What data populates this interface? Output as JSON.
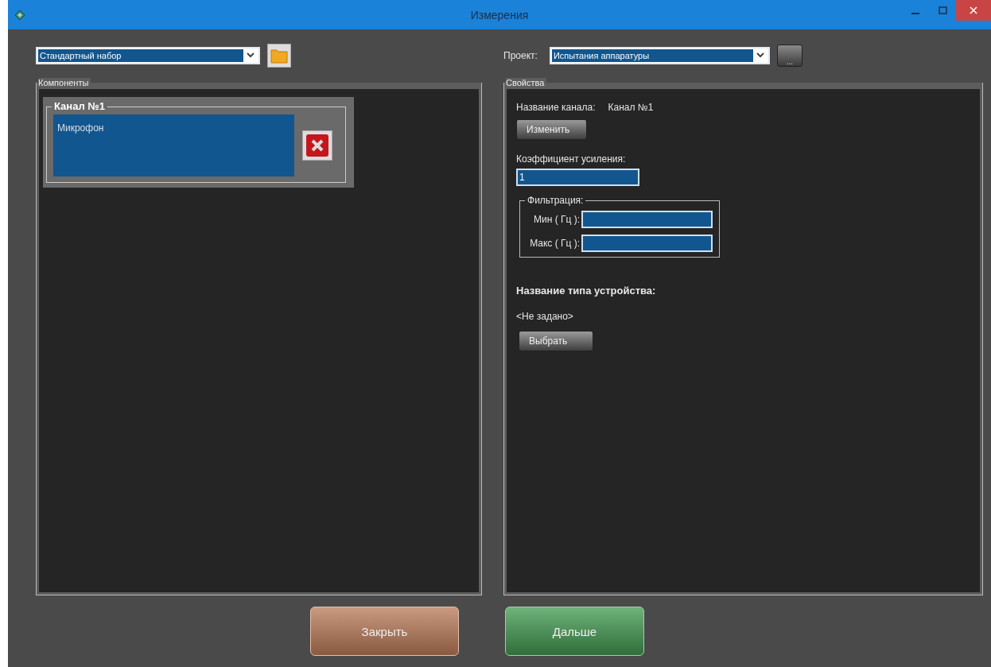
{
  "window": {
    "title": "Измерения"
  },
  "preset": {
    "value": "Стандартный набор"
  },
  "project": {
    "label": "Проект:",
    "value": "Испытания аппаратуры",
    "browse": "..."
  },
  "components": {
    "title": "Компоненты",
    "channels": [
      {
        "title": "Канал №1",
        "items": [
          {
            "name": "Микрофон"
          }
        ]
      }
    ]
  },
  "properties": {
    "title": "Свойства",
    "channel_name_label": "Название канала:",
    "channel_name": "Канал №1",
    "change_button": "Изменить",
    "gain_label": "Коэффициент усиления:",
    "gain_value": "1",
    "filter": {
      "title": "Фильтрация:",
      "min_label": "Мин ( Гц ):",
      "max_label": "Макс ( Гц ):"
    },
    "device_type_label": "Название типа устройства:",
    "device_type_value": "<Не задано>",
    "select_button": "Выбрать"
  },
  "buttons": [
    {
      "label": "Закрыть",
      "kind": "close"
    },
    {
      "label": "Дальше",
      "kind": "next"
    }
  ]
}
